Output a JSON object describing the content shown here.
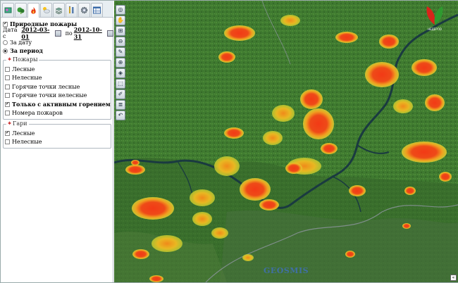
{
  "tabs": [
    {
      "icon": "layers-icon"
    },
    {
      "icon": "forest-icon"
    },
    {
      "icon": "fire-icon",
      "active": true
    },
    {
      "icon": "weather-icon"
    },
    {
      "icon": "stack-icon"
    },
    {
      "icon": "tools-icon"
    },
    {
      "icon": "gear-icon"
    },
    {
      "icon": "table-icon"
    }
  ],
  "fires": {
    "main_label": "Природные пожары",
    "main_checked": true,
    "date_label": "Дата с",
    "date_from": "2012-03-01",
    "date_to_label": "по",
    "date_to": "2012-10-31",
    "mode_by_date": "За дату",
    "mode_period": "За период",
    "selected_mode": "period"
  },
  "fires_group": {
    "legend": "Пожары",
    "items": [
      {
        "label": "Лесные",
        "checked": false,
        "bold": false
      },
      {
        "label": "Нелесные",
        "checked": false,
        "bold": false
      },
      {
        "label": "Горячие точки лесные",
        "checked": false,
        "bold": false
      },
      {
        "label": "Горячие точки нелесные",
        "checked": false,
        "bold": false
      },
      {
        "label": "Только с активным горением",
        "checked": true,
        "bold": true
      },
      {
        "label": "Номера пожаров",
        "checked": false,
        "bold": false
      }
    ]
  },
  "burns_group": {
    "legend": "Гари",
    "items": [
      {
        "label": "Лесные",
        "checked": true
      },
      {
        "label": "Нелесные",
        "checked": false
      }
    ]
  },
  "map": {
    "watermark": "GEOSMIS",
    "logo_caption": "НЕДЕРПО",
    "tools": [
      "pan",
      "zoom-box",
      "zoom-in",
      "zoom-out",
      "measure",
      "identify",
      "layers",
      "select",
      "draw",
      "print",
      "undo"
    ],
    "colors": {
      "forest": "#3f7a30",
      "burn_red": "#e8251a",
      "burn_orange": "#f08a1a",
      "burn_yellow": "#e8d22a",
      "river": "#1a3a40"
    }
  }
}
